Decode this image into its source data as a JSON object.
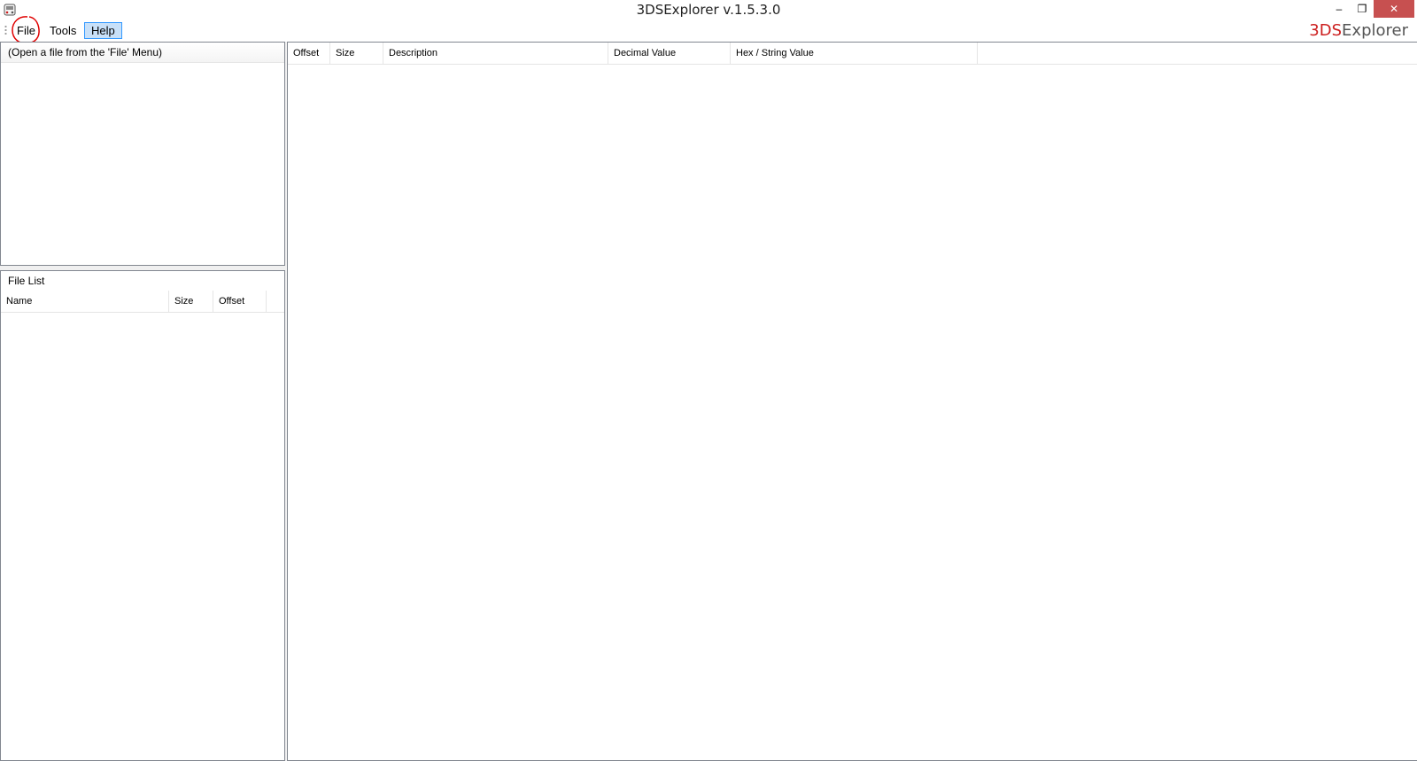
{
  "window": {
    "title": "3DSExplorer v.1.5.3.0",
    "minimize_glyph": "–",
    "maximize_glyph": "❐",
    "close_glyph": "✕"
  },
  "menu": {
    "items": [
      {
        "label": "File"
      },
      {
        "label": "Tools"
      },
      {
        "label": "Help"
      }
    ]
  },
  "brand": {
    "prefix": "3DS",
    "rest": "Explorer",
    "accent_color": "#cc1f1f"
  },
  "tree_panel": {
    "header": "(Open a file from the 'File' Menu)"
  },
  "file_list": {
    "title": "File List",
    "columns": [
      "Name",
      "Size",
      "Offset"
    ]
  },
  "detail_table": {
    "columns": [
      "Offset",
      "Size",
      "Description",
      "Decimal Value",
      "Hex / String Value"
    ]
  },
  "colors": {
    "close_button": "#c75050",
    "menu_highlight": "#c8e0f8",
    "menu_highlight_border": "#3399ff",
    "annotation": "#e00000"
  }
}
